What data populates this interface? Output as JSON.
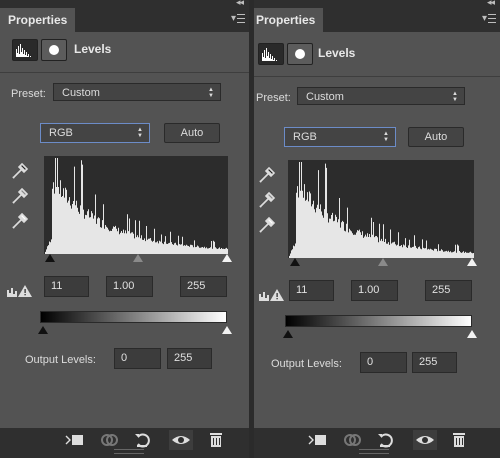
{
  "panels": [
    {
      "tab_title": "Properties",
      "collapse_glyph": "◂◂",
      "header_title": "Levels",
      "preset_label": "Preset:",
      "preset_value": "Custom",
      "channel_value": "RGB",
      "auto_label": "Auto",
      "input_black": "11",
      "input_gamma": "1.00",
      "input_white": "255",
      "output_label": "Output Levels:",
      "output_black": "0",
      "output_white": "255"
    },
    {
      "tab_title": "Properties",
      "collapse_glyph": "◂◂",
      "header_title": "Levels",
      "preset_label": "Preset:",
      "preset_value": "Custom",
      "channel_value": "RGB",
      "auto_label": "Auto",
      "input_black": "11",
      "input_gamma": "1.00",
      "input_white": "255",
      "output_label": "Output Levels:",
      "output_black": "0",
      "output_white": "255"
    }
  ],
  "icons": {
    "collapse": "double-left-arrow",
    "panel_menu": "panel-menu-icon",
    "footer": [
      "clip-to-layer-icon",
      "view-previous-state-icon",
      "reset-icon",
      "visibility-eye-icon",
      "delete-icon"
    ]
  },
  "colors": {
    "panel_bg": "#535353",
    "dark_bar": "#2f2f2f",
    "focus_border": "#6c8cc8",
    "histogram_fill": "#e6e6e6"
  }
}
